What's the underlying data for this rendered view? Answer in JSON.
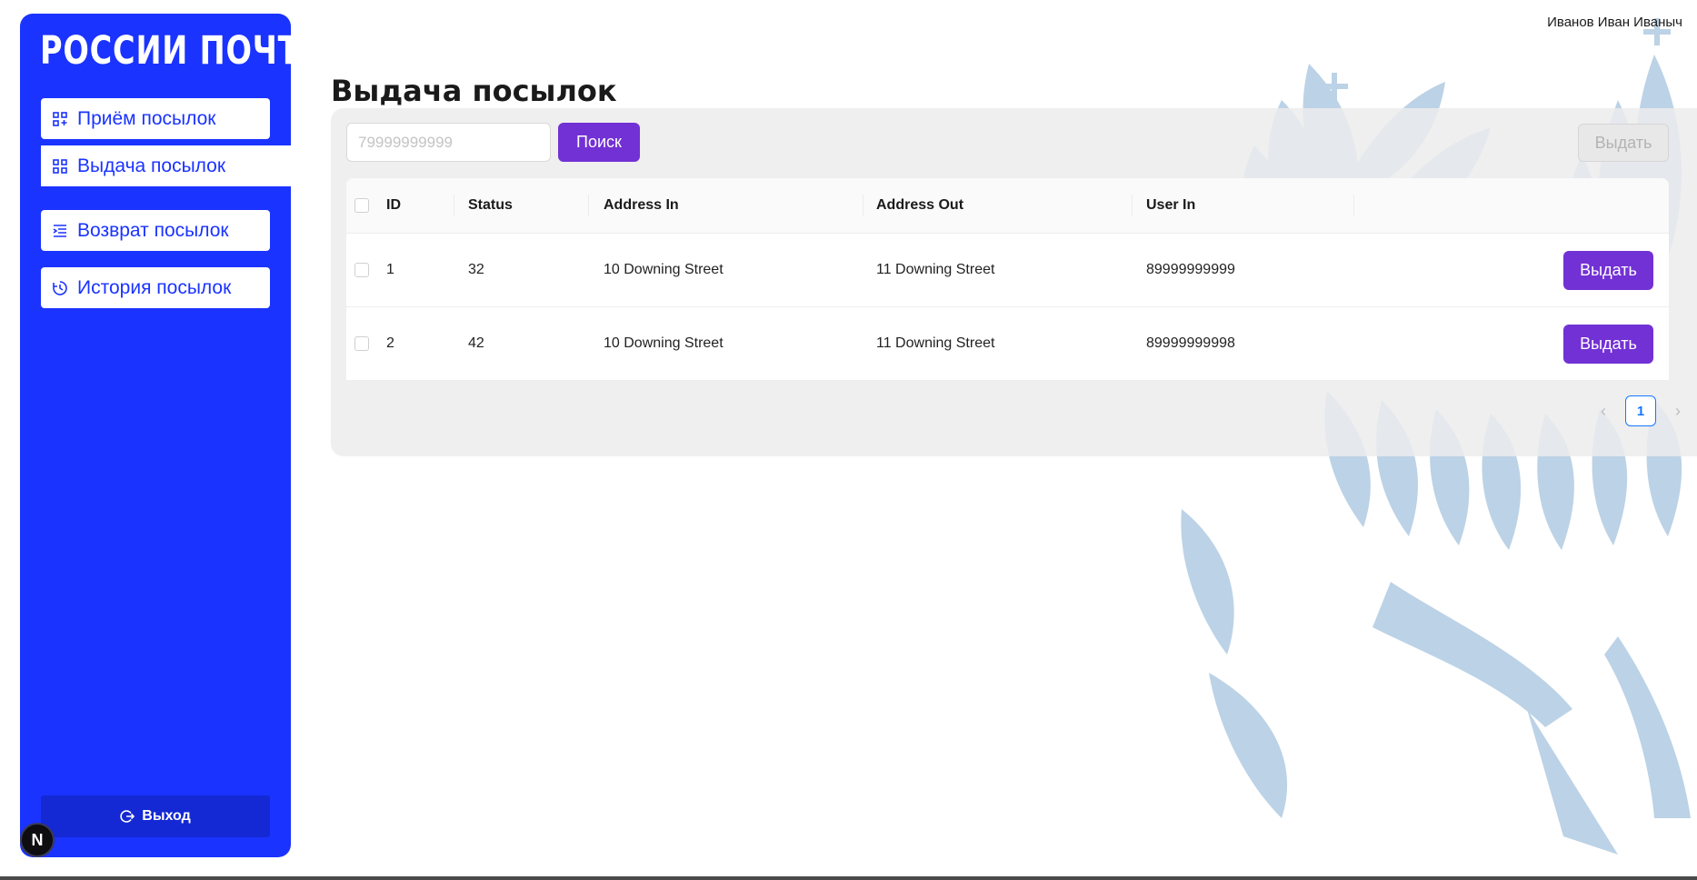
{
  "header": {
    "user_name": "Иванов Иван Иваныч"
  },
  "sidebar": {
    "logo": "РОССИИ ПОЧТА",
    "items": [
      {
        "label": "Приём посылок",
        "icon": "grid-add-icon"
      },
      {
        "label": "Выдача посылок",
        "icon": "grid-icon",
        "active": true
      },
      {
        "label": "Возврат посылок",
        "icon": "list-indent-icon"
      },
      {
        "label": "История посылок",
        "icon": "history-icon"
      }
    ],
    "logout_label": "Выход"
  },
  "page": {
    "title": "Выдача посылок"
  },
  "search": {
    "placeholder": "79999999999",
    "value": "",
    "button_label": "Поиск"
  },
  "toolbar": {
    "issue_label": "Выдать"
  },
  "table": {
    "columns": [
      "ID",
      "Status",
      "Address In",
      "Address Out",
      "User In"
    ],
    "rows": [
      {
        "id": "1",
        "status": "32",
        "address_in": "10 Downing Street",
        "address_out": "11 Downing Street",
        "user_in": "89999999999",
        "action": "Выдать"
      },
      {
        "id": "2",
        "status": "42",
        "address_in": "10 Downing Street",
        "address_out": "11 Downing Street",
        "user_in": "89999999998",
        "action": "Выдать"
      }
    ]
  },
  "pagination": {
    "current_page": "1"
  },
  "dev_badge": "N",
  "colors": {
    "brand": "#1a33ff",
    "accent": "#7231d4",
    "link": "#1677ff"
  }
}
